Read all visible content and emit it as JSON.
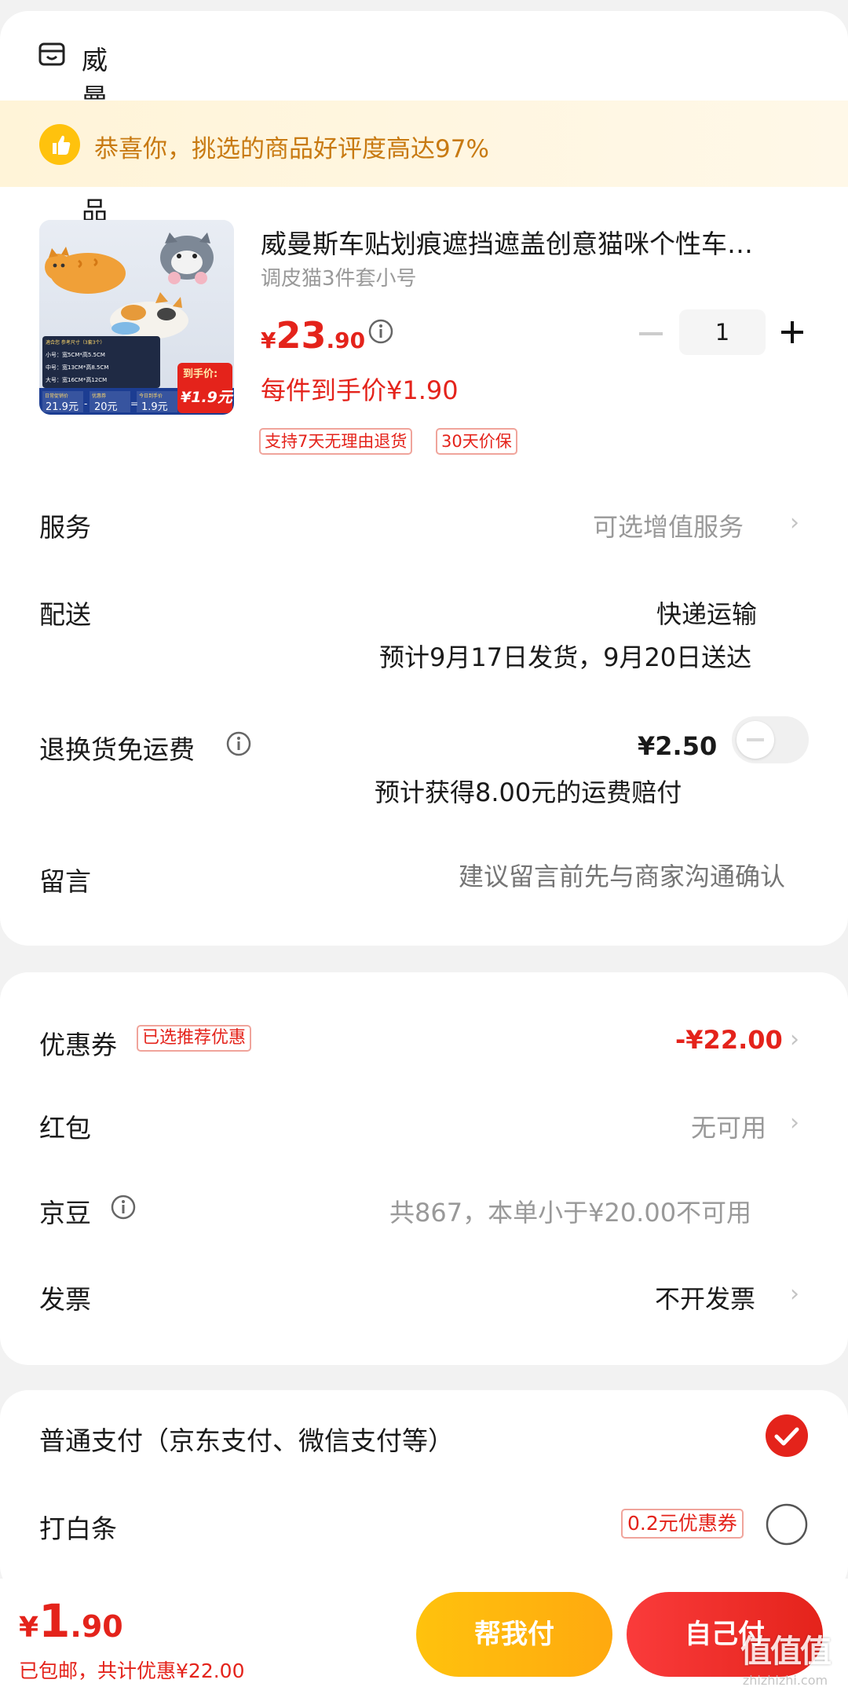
{
  "shop": {
    "name": "威曼斯车品优创店",
    "icon": "shop-icon"
  },
  "banner": {
    "text": "恭喜你，挑选的商品好评度高达97%",
    "icon": "thumbs-up-icon"
  },
  "product": {
    "title": "威曼斯车贴划痕遮挡遮盖创意猫咪个性车…",
    "spec": "调皮猫3件套小号",
    "currency": "¥",
    "price_int": "23",
    "price_dec": ".90",
    "unit_price_label": "每件到手价¥1.90",
    "quantity": "1",
    "tags": [
      "支持7天无理由退货",
      "30天价保"
    ],
    "thumb": {
      "badge_label": "到手价:",
      "badge_price": "¥1.9元",
      "size_title": "適合您 参考尺寸（3套3个）",
      "sizes": [
        "小号：宽5CM*高5.5CM",
        "中号：宽13CM*高8.5CM",
        "大号：宽16CM*高12CM"
      ],
      "calc": [
        {
          "label": "日常促销价",
          "value": "21.9元"
        },
        {
          "label": "优惠券",
          "value": "20元"
        },
        {
          "label": "今日到手价",
          "value": "1.9元"
        }
      ],
      "calc_ops": [
        "-",
        "="
      ]
    }
  },
  "rows": {
    "service": {
      "label": "服务",
      "value": "可选增值服务"
    },
    "delivery": {
      "label": "配送",
      "method": "快递运输",
      "eta": "预计9月17日发货，9月20日送达"
    },
    "return_fee": {
      "label": "退换货免运费",
      "price": "¥2.50",
      "note": "预计获得8.00元的运费赔付"
    },
    "message": {
      "label": "留言",
      "placeholder": "建议留言前先与商家沟通确认"
    }
  },
  "discounts": {
    "coupon": {
      "label": "优惠券",
      "badge": "已选推荐优惠",
      "value": "-¥22.00"
    },
    "red_packet": {
      "label": "红包",
      "value": "无可用"
    },
    "jingdou": {
      "label": "京豆",
      "value": "共867，本单小于¥20.00不可用"
    },
    "invoice": {
      "label": "发票",
      "value": "不开发票"
    }
  },
  "payment": {
    "normal": {
      "label": "普通支付（京东支付、微信支付等）",
      "selected": true
    },
    "baitiao": {
      "label": "打白条",
      "badge": "0.2元优惠券",
      "selected": false
    }
  },
  "footer": {
    "currency": "¥",
    "total_int": "1",
    "total_dec": ".90",
    "shipping_note": "已包邮，共计优惠",
    "discount_total": "¥22.00",
    "help_pay": "帮我付",
    "self_pay": "自己付"
  },
  "watermark": {
    "text": "值值值",
    "site": "zhizhizhi.com"
  },
  "colors": {
    "accent": "#e4231b",
    "gold": "#ffb80f",
    "banner_text": "#c87a12"
  }
}
